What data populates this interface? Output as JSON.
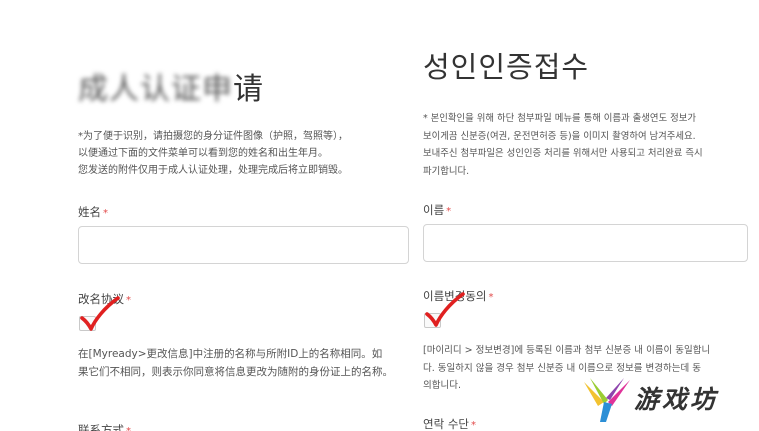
{
  "left": {
    "title": "成人认证申请",
    "notice_lines": [
      "*为了便于识别，请拍摄您的身分证件图像（护照，驾照等），",
      "以便通过下面的文件菜单可以看到您的姓名和出生年月。",
      "您发送的附件仅用于成人认证处理，处理完成后将立即销毁。"
    ],
    "name_label": "姓名",
    "consent_label": "改名协议",
    "consent_desc_lines": [
      "在[Myready>更改信息]中注册的名称与所附ID上的名称相同。如",
      "果它们不相同，则表示你同意将信息更改为随附的身份证上的名称。"
    ],
    "contact_label": "联系方式",
    "required_mark": "*"
  },
  "right": {
    "title": "성인인증접수",
    "notice_lines": [
      "* 본인확인을 위해 하단 첨부파일 메뉴를 통해 이름과 출생연도 정보가",
      "보이게끔 신분증(여권, 운전면허증 등)을 이미지 촬영하여 남겨주세요.",
      "보내주신 첨부파일은 성인인증 처리를 위해서만 사용되고 처리완료 즉시",
      "파기합니다."
    ],
    "name_label": "이름",
    "consent_label": "이름변경동의",
    "consent_desc_lines": [
      "[마이리디 > 정보변경]에 등록된 이름과 첨부 신분증 내 이름이 동일합니",
      "다. 동일하지 않을 경우 첨부 신분증 내 이름으로 정보를 변경하는데 동",
      "의합니다."
    ],
    "contact_label": "연락 수단",
    "required_mark": "*"
  },
  "watermark": {
    "text": "游戏坊"
  },
  "colors": {
    "required": "#e24a4a",
    "check_mark": "#e02020",
    "border": "#d4d4d4"
  }
}
